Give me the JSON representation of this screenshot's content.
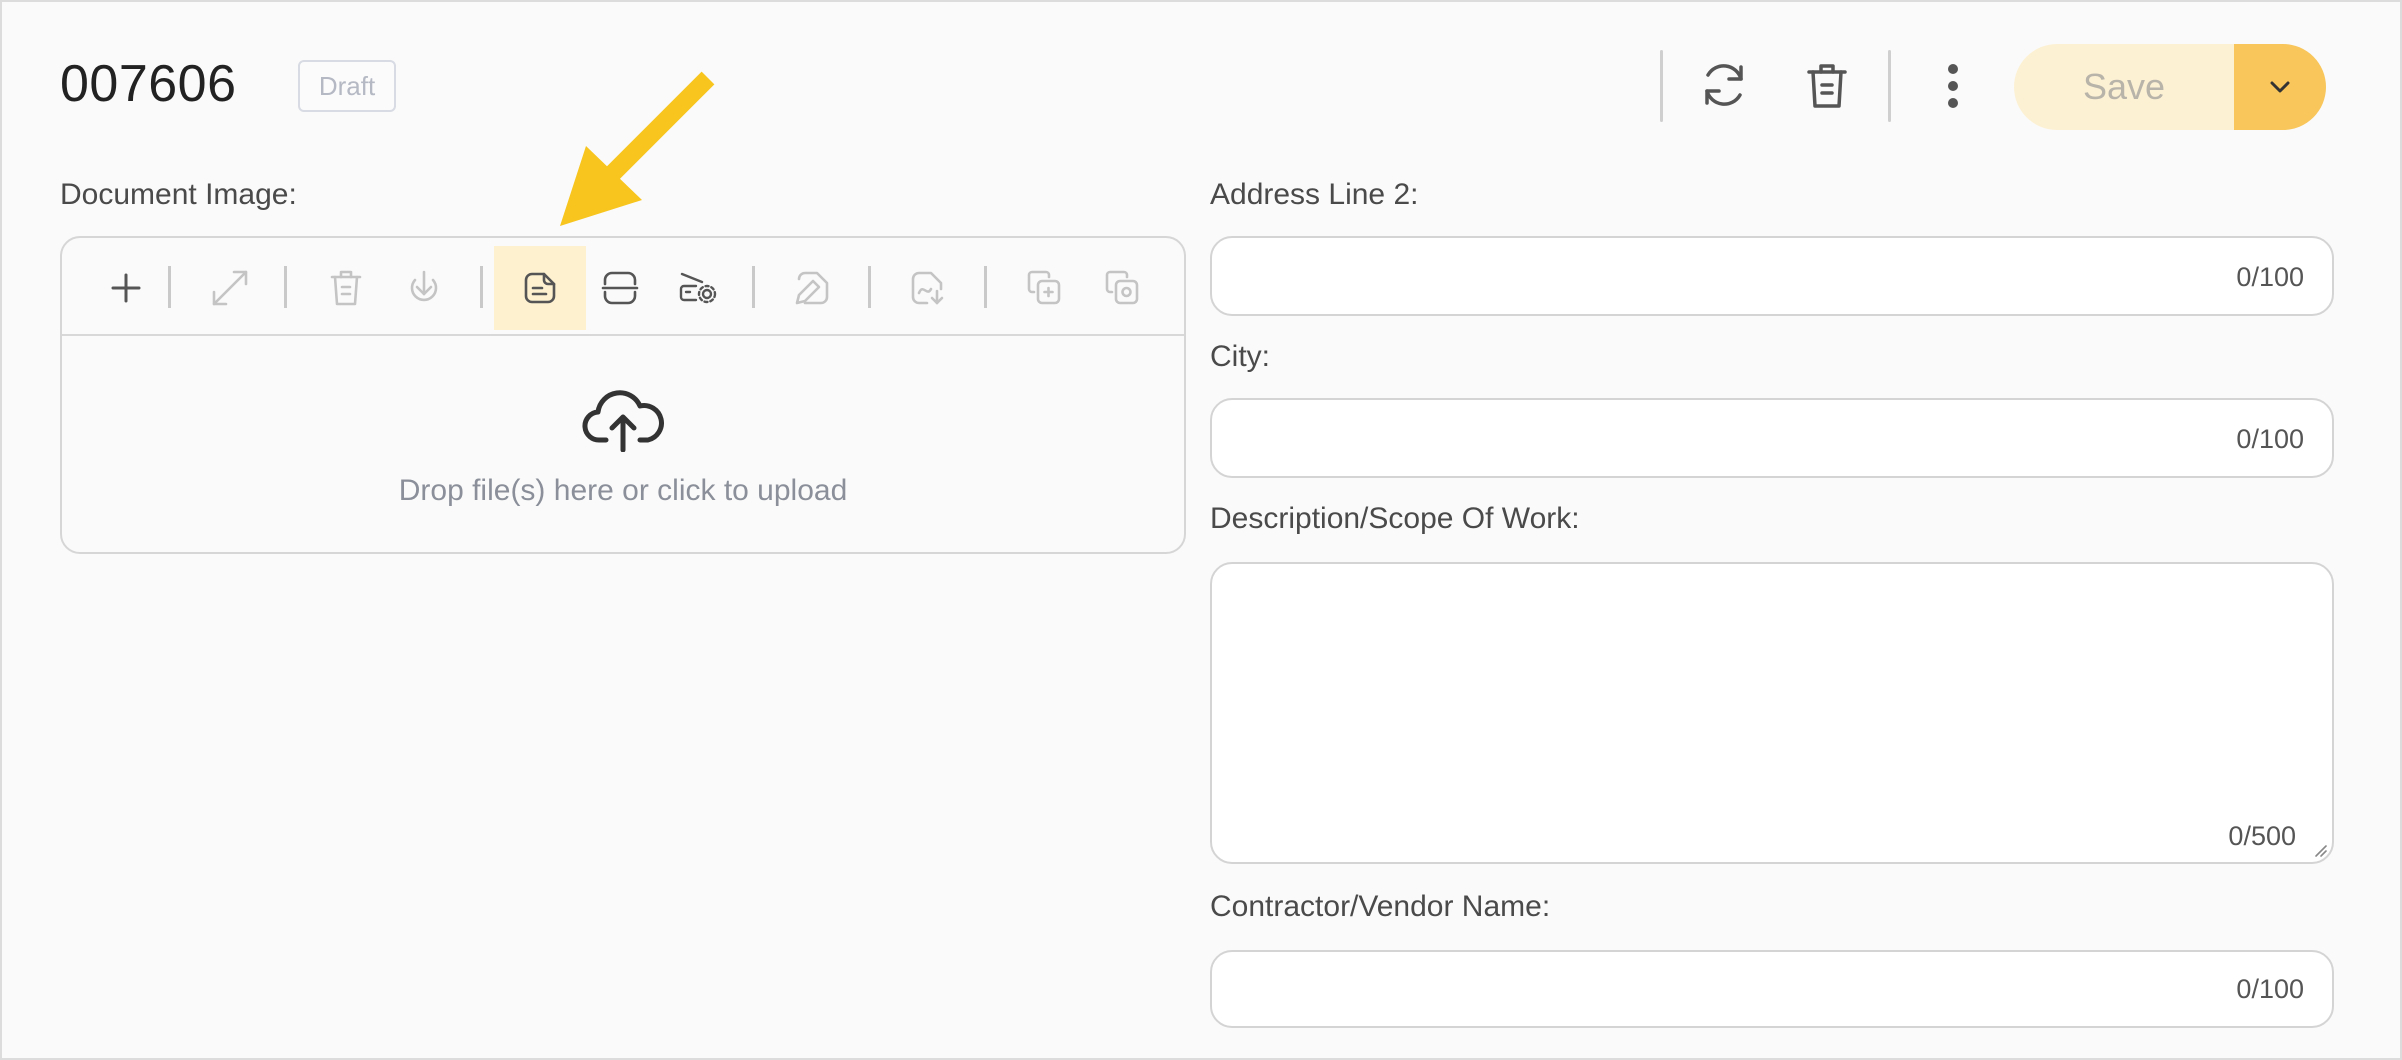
{
  "header": {
    "record_id": "007606",
    "status": "Draft",
    "refresh_label": "refresh",
    "save_label": "Save"
  },
  "document_image": {
    "label": "Document Image:",
    "toolbar": [
      {
        "name": "add-icon",
        "enabled": true
      },
      {
        "name": "expand-icon",
        "enabled": false
      },
      {
        "name": "delete-icon",
        "enabled": false
      },
      {
        "name": "download-icon",
        "enabled": false
      },
      {
        "name": "note-icon",
        "enabled": true,
        "active": true
      },
      {
        "name": "split-icon",
        "enabled": true
      },
      {
        "name": "scan-settings-icon",
        "enabled": true
      },
      {
        "name": "sign-icon",
        "enabled": false
      },
      {
        "name": "export-pdf-icon",
        "enabled": false
      },
      {
        "name": "copy-add-icon",
        "enabled": false
      },
      {
        "name": "copy-settings-icon",
        "enabled": false
      }
    ],
    "dropzone_text": "Drop file(s) here or click to upload"
  },
  "fields": {
    "address_line_2": {
      "label": "Address Line 2:",
      "value": "",
      "counter": "0/100"
    },
    "city": {
      "label": "City:",
      "value": "",
      "counter": "0/100"
    },
    "description": {
      "label": "Description/Scope Of Work:",
      "value": "",
      "counter": "0/500"
    },
    "contractor": {
      "label": "Contractor/Vendor Name:",
      "value": "",
      "counter": "0/100"
    }
  },
  "colors": {
    "accent": "#f8c65b",
    "accent_light": "#fdf1d4",
    "annotation_arrow": "#f7c51e"
  }
}
